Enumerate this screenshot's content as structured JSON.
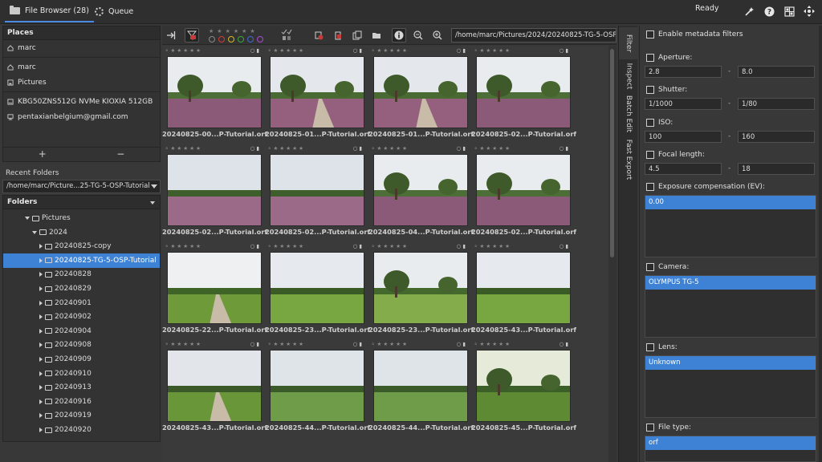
{
  "topbar": {
    "tabs": [
      {
        "label": "File Browser (28)",
        "icon": "folder-icon"
      },
      {
        "label": "Queue",
        "icon": "gear-icon"
      }
    ],
    "status": "Ready",
    "right_icons": [
      "wand-icon",
      "help-icon",
      "grid-icon",
      "move-icon"
    ]
  },
  "places": {
    "title": "Places",
    "items": [
      "marc",
      "marc",
      "Pictures",
      "KBG50ZNS512G NVMe KIOXIA 512GB",
      "pentaxianbelgium@gmail.com"
    ],
    "add_label": "+",
    "remove_label": "−"
  },
  "recent": {
    "title": "Recent Folders",
    "value": "/home/marc/Picture...25-TG-5-OSP-Tutorial"
  },
  "folders": {
    "title": "Folders",
    "items": [
      {
        "label": "Pictures",
        "level": 1,
        "expanded": true
      },
      {
        "label": "2024",
        "level": 2,
        "expanded": true
      },
      {
        "label": "20240825-copy",
        "level": 3
      },
      {
        "label": "20240825-TG-5-OSP-Tutorial",
        "level": 3,
        "selected": true
      },
      {
        "label": "20240828",
        "level": 3
      },
      {
        "label": "20240829",
        "level": 3
      },
      {
        "label": "20240901",
        "level": 3
      },
      {
        "label": "20240902",
        "level": 3
      },
      {
        "label": "20240904",
        "level": 3
      },
      {
        "label": "20240908",
        "level": 3
      },
      {
        "label": "20240909",
        "level": 3
      },
      {
        "label": "20240910",
        "level": 3
      },
      {
        "label": "20240913",
        "level": 3
      },
      {
        "label": "20240916",
        "level": 3
      },
      {
        "label": "20240919",
        "level": 3
      },
      {
        "label": "20240920",
        "level": 3
      }
    ]
  },
  "toolbar": {
    "path": "/home/marc/Pictures/2024/20240825-TG-5-OSP",
    "label_colors": [
      "#888888",
      "#d23a3a",
      "#d6b820",
      "#3aa63a",
      "#3a6ad2",
      "#a64ad2"
    ],
    "icons": [
      "panel-toggle-icon",
      "filter-icon",
      "trash-filter-icon",
      "edited-icon",
      "copy-icon",
      "folder-icon",
      "info-icon",
      "zoom-out-icon",
      "zoom-in-icon"
    ]
  },
  "thumbnails": [
    {
      "name": "20240825-00...P-Tutorial.orf",
      "scene": "heath-tree"
    },
    {
      "name": "20240825-01...P-Tutorial.orf",
      "scene": "heath-path"
    },
    {
      "name": "20240825-01...P-Tutorial.orf",
      "scene": "heath-path"
    },
    {
      "name": "20240825-02...P-Tutorial.orf",
      "scene": "heath-tree"
    },
    {
      "name": "20240825-02...P-Tutorial.orf",
      "scene": "heath-field"
    },
    {
      "name": "20240825-02...P-Tutorial.orf",
      "scene": "heath-field"
    },
    {
      "name": "20240825-04...P-Tutorial.orf",
      "scene": "heath-tree"
    },
    {
      "name": "20240825-02...P-Tutorial.orf",
      "scene": "heath-tree"
    },
    {
      "name": "20240825-22...P-Tutorial.orf",
      "scene": "grass-path"
    },
    {
      "name": "20240825-23...P-Tutorial.orf",
      "scene": "grass-field"
    },
    {
      "name": "20240825-23...P-Tutorial.orf",
      "scene": "grass-house"
    },
    {
      "name": "20240825-43...P-Tutorial.orf",
      "scene": "grass-field"
    },
    {
      "name": "20240825-43...P-Tutorial.orf",
      "scene": "road"
    },
    {
      "name": "20240825-44...P-Tutorial.orf",
      "scene": "crop"
    },
    {
      "name": "20240825-44...P-Tutorial.orf",
      "scene": "crop"
    },
    {
      "name": "20240825-45...P-Tutorial.orf",
      "scene": "fence"
    }
  ],
  "side_tabs": [
    "Filter",
    "Inspect",
    "Batch Edit",
    "Fast Export"
  ],
  "filter": {
    "enable_label": "Enable metadata filters",
    "aperture": {
      "label": "Aperture:",
      "min": "2.8",
      "max": "8.0"
    },
    "shutter": {
      "label": "Shutter:",
      "min": "1/1000",
      "max": "1/80"
    },
    "iso": {
      "label": "ISO:",
      "min": "100",
      "max": "160"
    },
    "focal": {
      "label": "Focal length:",
      "min": "4.5",
      "max": "18"
    },
    "exposure": {
      "label": "Exposure compensation (EV):",
      "value": "0.00"
    },
    "camera": {
      "label": "Camera:",
      "value": "OLYMPUS TG-5"
    },
    "lens": {
      "label": "Lens:",
      "value": "Unknown"
    },
    "filetype": {
      "label": "File type:",
      "value": "orf"
    },
    "range_sep": "-"
  }
}
